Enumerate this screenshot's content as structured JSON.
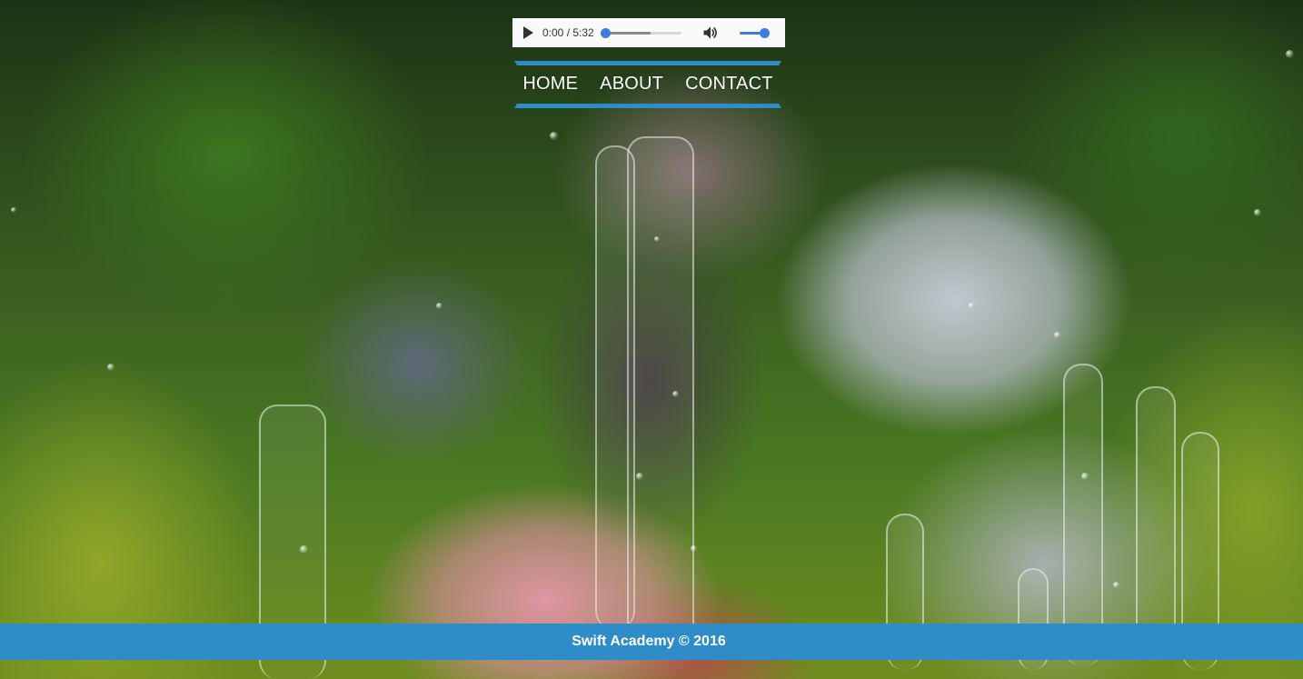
{
  "player": {
    "time_current": "0:00",
    "time_separator": " / ",
    "time_total": "5:32",
    "progress": 0,
    "buffered": 0.6,
    "volume": 1,
    "accent_color": "#3a7fe0"
  },
  "nav": {
    "items": [
      {
        "label": "HOME"
      },
      {
        "label": "ABOUT"
      },
      {
        "label": "CONTACT"
      }
    ],
    "bar_color": "#2e8cc9"
  },
  "footer": {
    "text": "Swift Academy © 2016",
    "background_color": "#2e8dc8"
  }
}
